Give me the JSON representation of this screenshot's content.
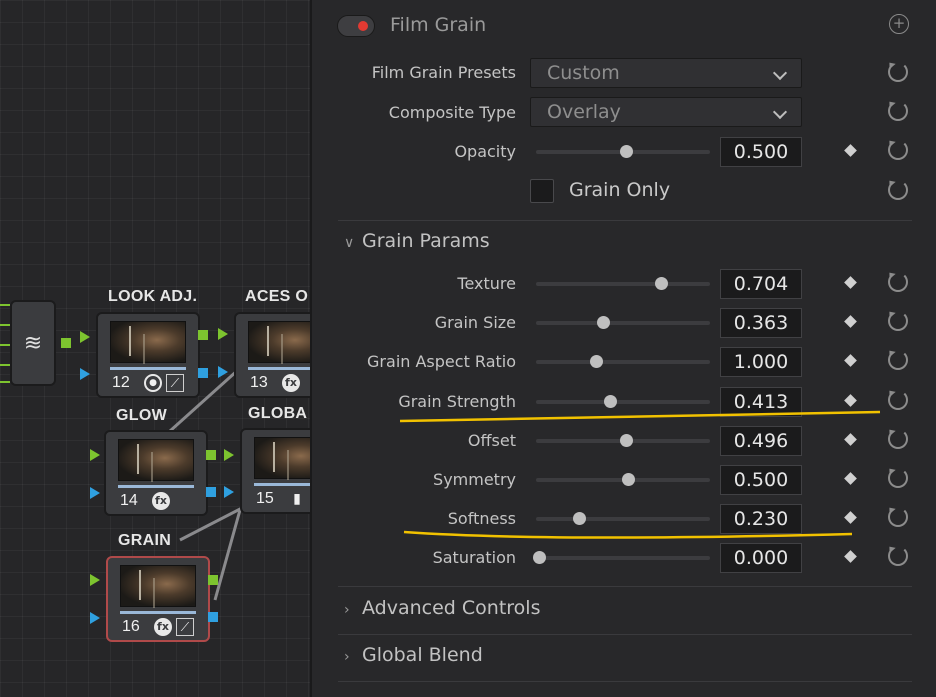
{
  "graph": {
    "nodes": [
      {
        "title": "LOOK ADJ.",
        "number": "12",
        "icons": [
          "circle-icon",
          "curve-icon"
        ]
      },
      {
        "title": "ACES O",
        "number": "13",
        "icons": [
          "fx-icon"
        ]
      },
      {
        "title": "GLOW",
        "number": "14",
        "icons": [
          "fx-icon"
        ]
      },
      {
        "title": "GLOBA",
        "number": "15",
        "icons": [
          "bars-icon"
        ]
      },
      {
        "title": "GRAIN",
        "number": "16",
        "icons": [
          "fx-icon",
          "curve-icon"
        ]
      }
    ]
  },
  "panel": {
    "title": "Film Grain",
    "presets": {
      "label": "Film Grain Presets",
      "value": "Custom"
    },
    "composite": {
      "label": "Composite Type",
      "value": "Overlay"
    },
    "opacity": {
      "label": "Opacity",
      "value": "0.500",
      "level": 0.5
    },
    "grain_only": {
      "label": "Grain Only",
      "checked": false
    },
    "grain_params": {
      "label": "Grain Params",
      "params": [
        {
          "label": "Texture",
          "value": "0.704",
          "level": 0.7
        },
        {
          "label": "Grain Size",
          "value": "0.363",
          "level": 0.37
        },
        {
          "label": "Grain Aspect Ratio",
          "value": "1.000",
          "level": 0.33
        },
        {
          "label": "Grain Strength",
          "value": "0.413",
          "level": 0.41
        },
        {
          "label": "Offset",
          "value": "0.496",
          "level": 0.5
        },
        {
          "label": "Symmetry",
          "value": "0.500",
          "level": 0.51
        },
        {
          "label": "Softness",
          "value": "0.230",
          "level": 0.23
        },
        {
          "label": "Saturation",
          "value": "0.000",
          "level": 0.0
        }
      ]
    },
    "advanced": {
      "label": "Advanced Controls"
    },
    "global_blend": {
      "label": "Global Blend"
    }
  },
  "colors": {
    "accent_red": "#e23a32",
    "highlight": "#f2c200",
    "port_green": "#7dc42f",
    "port_blue": "#2fa0e0"
  }
}
